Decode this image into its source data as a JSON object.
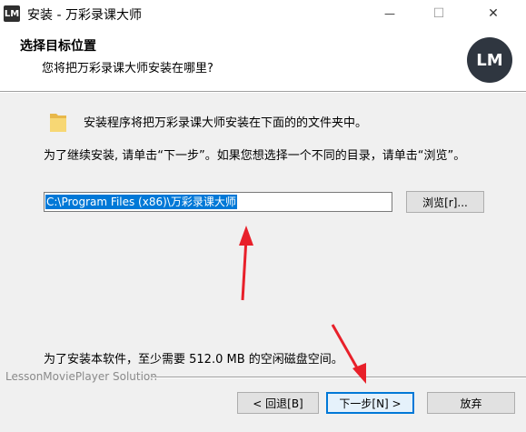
{
  "window": {
    "icon_text": "LM",
    "title": "安装 - 万彩录课大师",
    "min_glyph": "—",
    "max_glyph": "☐",
    "close_glyph": "✕"
  },
  "header": {
    "title": "选择目标位置",
    "subtitle": "您将把万彩录课大师安装在哪里?",
    "logo_text": "LM"
  },
  "body": {
    "intro": "安装程序将把万彩录课大师安装在下面的的文件夹中。",
    "instruction": "为了继续安装, 请单击“下一步”。如果您想选择一个不同的目录，请单击“浏览”。",
    "path_value": "C:\\Program Files (x86)\\万彩录课大师",
    "browse_label": "浏览[r]...",
    "space_required": "为了安装本软件，至少需要 512.0 MB 的空闲磁盘空间。"
  },
  "footer": {
    "brand": "LessonMoviePlayer Solution",
    "back_label": "< 回退[B]",
    "next_label": "下一步[N] >",
    "cancel_label": "放弃"
  },
  "colors": {
    "annotation_arrow": "#e8202a",
    "selection": "#0078d7"
  }
}
